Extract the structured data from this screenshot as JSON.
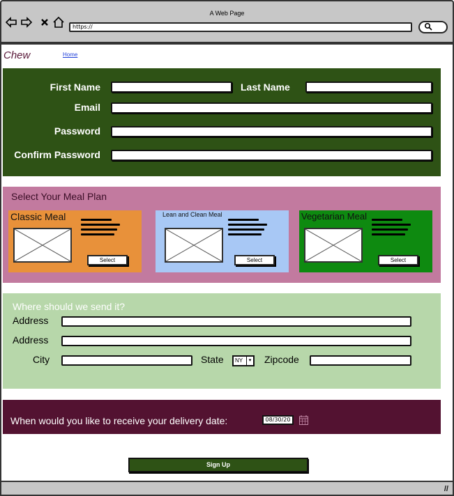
{
  "browser": {
    "title": "A Web Page",
    "url": "https://",
    "back_icon": "back-arrow-icon",
    "forward_icon": "forward-arrow-icon",
    "stop_icon": "close-icon",
    "home_icon": "home-icon",
    "search_icon": "search-icon",
    "resize_icon": "resize-grip-icon"
  },
  "header": {
    "brand": "Chew",
    "home_link": "Home"
  },
  "account_form": {
    "first_name_label": "First Name",
    "last_name_label": "Last  Name",
    "email_label": "Email",
    "password_label": "Password",
    "confirm_password_label": "Confirm Password",
    "first_name_value": "",
    "last_name_value": "",
    "email_value": "",
    "password_value": "",
    "confirm_password_value": ""
  },
  "meal_plan": {
    "title": "Select Your Meal Plan",
    "cards": [
      {
        "name": "Classic Meal",
        "select_label": "Select",
        "color": "#e8913a"
      },
      {
        "name": "Lean and Clean Meal",
        "select_label": "Select",
        "color": "#a8c8f5"
      },
      {
        "name": "Vegetarian Meal",
        "select_label": "Select",
        "color": "#0e8a10"
      }
    ]
  },
  "address": {
    "title": "Where should we send it?",
    "address1_label": "Address",
    "address2_label": "Address",
    "city_label": "City",
    "state_label": "State",
    "state_value": "NY",
    "zipcode_label": "Zipcode"
  },
  "delivery": {
    "question": "When would you like to receive your delivery date:",
    "date_value": "08/30/20",
    "calendar_icon": "calendar-icon"
  },
  "actions": {
    "signup_label": "Sign Up"
  },
  "colors": {
    "form_panel": "#2e5215",
    "meal_panel": "#c27a9f",
    "address_panel": "#b7d7aa",
    "delivery_panel": "#531231",
    "chrome": "#c7c7c7",
    "brand": "#5a1a3a"
  }
}
